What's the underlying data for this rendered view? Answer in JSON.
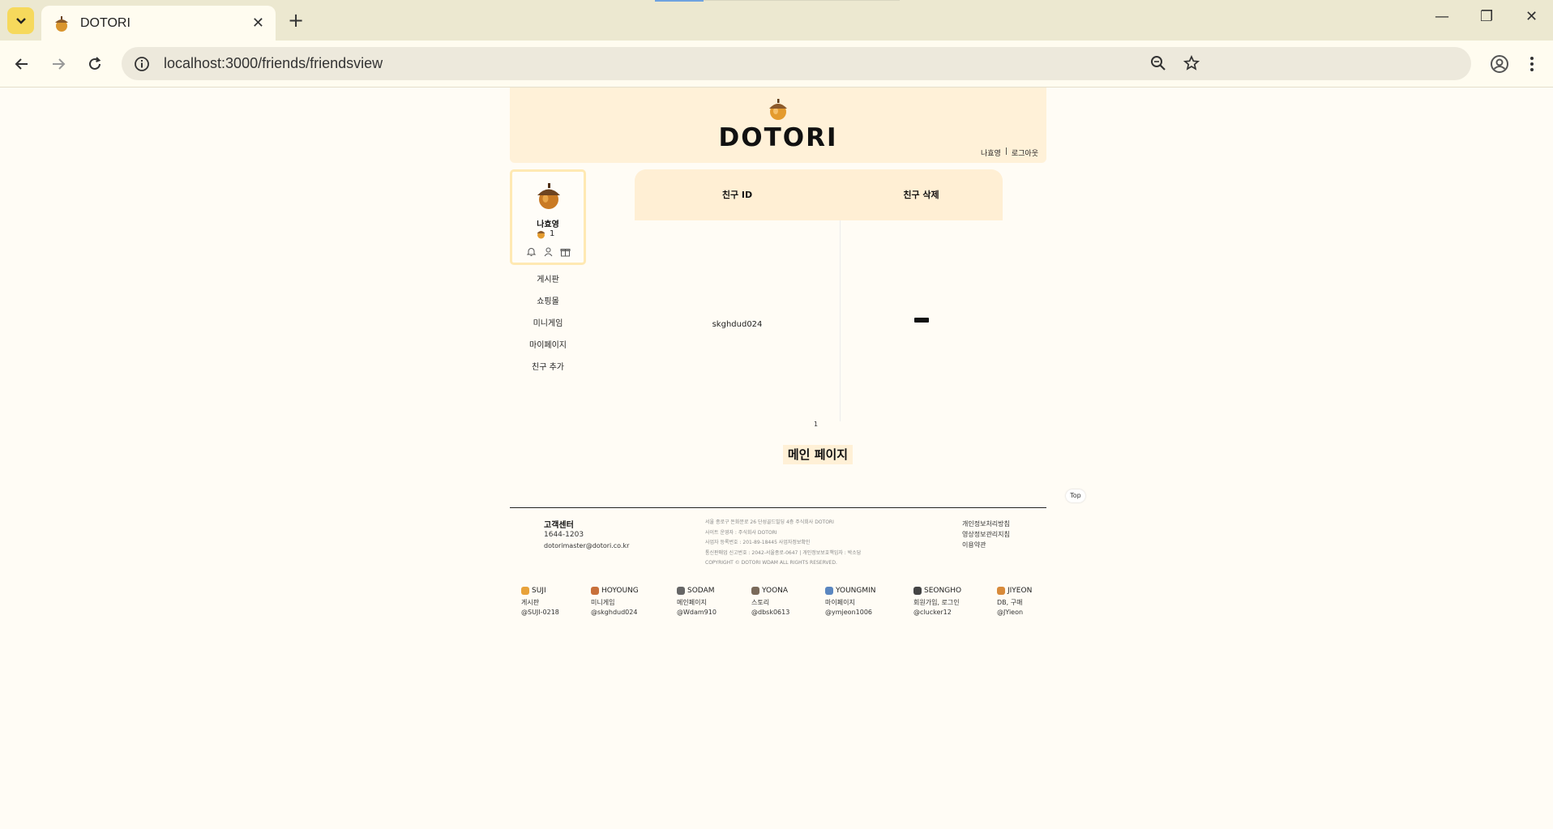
{
  "browser": {
    "tab_title": "DOTORI",
    "url": "localhost:3000/friends/friendsview"
  },
  "header": {
    "logo_text": "DOTORI",
    "user_name": "나효영",
    "separator": "|",
    "logout_label": "로그아웃"
  },
  "profile": {
    "name": "나효영",
    "acorn_count": "1"
  },
  "menu": {
    "items": [
      {
        "label": "게시판"
      },
      {
        "label": "쇼핑몰"
      },
      {
        "label": "미니게임"
      },
      {
        "label": "마이페이지"
      },
      {
        "label": "친구 추가"
      }
    ]
  },
  "friends_table": {
    "col_id": "친구 ID",
    "col_delete": "친구 삭제",
    "rows": [
      {
        "friend_id": "skghdud024"
      }
    ],
    "page": "1"
  },
  "main_page_button": "메인 페이지",
  "top_button": "Top",
  "footer": {
    "cs_title": "고객센터",
    "cs_phone": "1644-1203",
    "cs_email": "dotorimaster@dotori.co.kr",
    "address_lines": [
      "서울 종로구 돈화문로 26 단성골드빌딩 4층 주식회사 DOTORI",
      "사이트 운영자 : 주식회사 DOTORI",
      "사업자 등록번호 : 201-89-18445 사업자정보확인",
      "통신판매업 신고번호 : 2042-서울종로-0647 | 개인정보보호책임자 : 박소담",
      "COPYRIGHT © DOTORI WDAM ALL RIGHTS RESERVED."
    ],
    "policies": [
      "개인정보처리방침",
      "영상정보관리지침",
      "이용약관"
    ],
    "team": [
      {
        "name": "SUJI",
        "role": "게시판",
        "github": "@SUJI-0218",
        "icon_color": "#e8a23a"
      },
      {
        "name": "HOYOUNG",
        "role": "미니게임",
        "github": "@skghdud024",
        "icon_color": "#c8703a"
      },
      {
        "name": "SODAM",
        "role": "메인페이지",
        "github": "@Wdam910",
        "icon_color": "#666666"
      },
      {
        "name": "YOONA",
        "role": "스토리",
        "github": "@dbsk0613",
        "icon_color": "#7a6a5a"
      },
      {
        "name": "YOUNGMIN",
        "role": "마이페이지",
        "github": "@ymjeon1006",
        "icon_color": "#5a86c0"
      },
      {
        "name": "SEONGHO",
        "role": "회원가입, 로그인",
        "github": "@clucker12",
        "icon_color": "#444444"
      },
      {
        "name": "JIYEON",
        "role": "DB, 구매",
        "github": "@JYieon",
        "icon_color": "#d88a3a"
      }
    ]
  }
}
